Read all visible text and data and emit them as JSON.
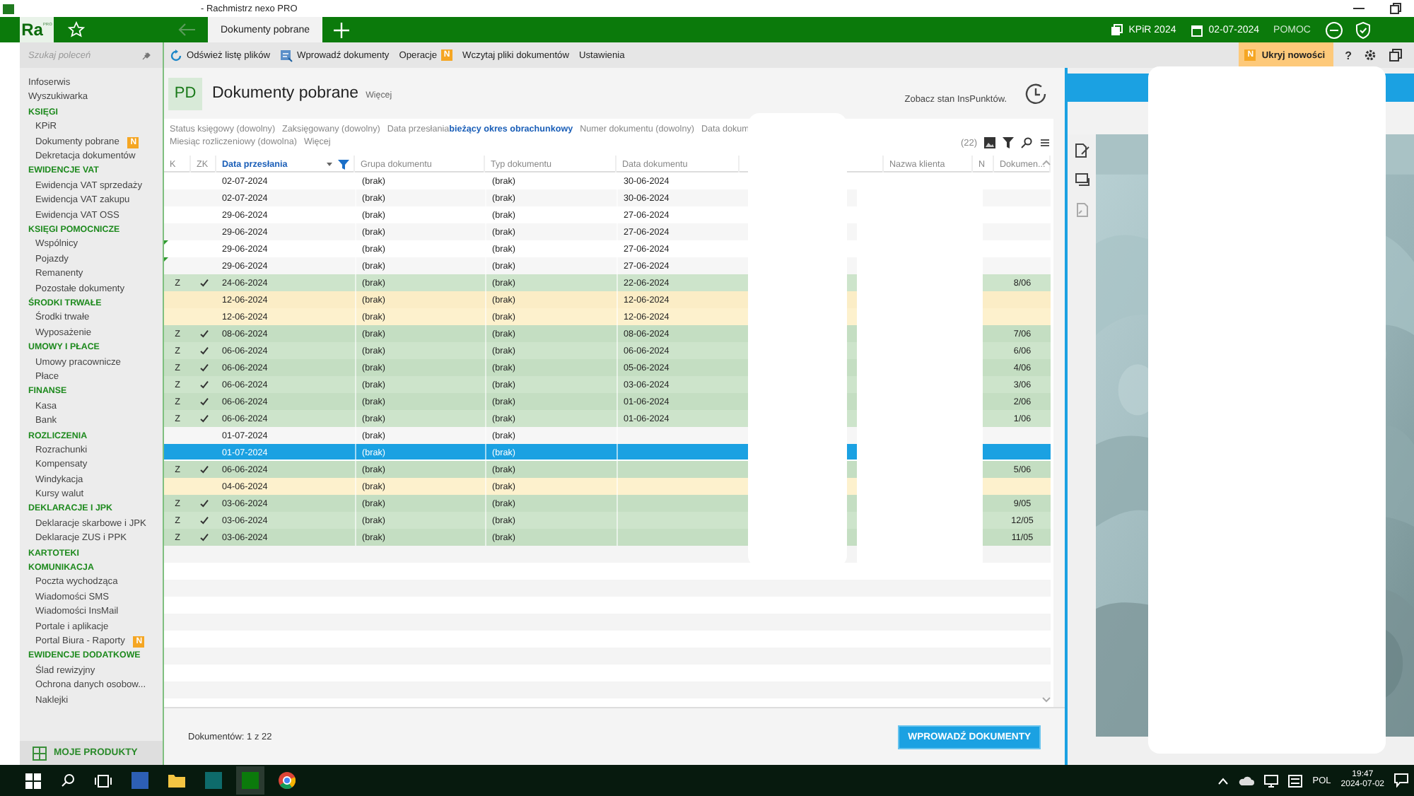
{
  "window": {
    "title": "- Rachmistrz nexo PRO"
  },
  "topbar": {
    "logo": "Ra",
    "logo_sup": "PRO",
    "tab": "Dokumenty pobrane",
    "year": "KPiR 2024",
    "date": "02-07-2024",
    "help": "POMOC"
  },
  "sidebar": {
    "search_placeholder": "Szukaj poleceń",
    "top_items": [
      "Infoserwis",
      "Wyszukiwarka"
    ],
    "sections": [
      {
        "title": "KSIĘGI",
        "items": [
          {
            "label": "KPiR"
          },
          {
            "label": "Dokumenty pobrane",
            "badge": "N"
          },
          {
            "label": "Dekretacja dokumentów"
          }
        ]
      },
      {
        "title": "EWIDENCJE VAT",
        "items": [
          {
            "label": "Ewidencja VAT sprzedaży"
          },
          {
            "label": "Ewidencja VAT zakupu"
          },
          {
            "label": "Ewidencja VAT OSS"
          }
        ]
      },
      {
        "title": "KSIĘGI POMOCNICZE",
        "items": [
          {
            "label": "Wspólnicy"
          },
          {
            "label": "Pojazdy"
          },
          {
            "label": "Remanenty"
          },
          {
            "label": "Pozostałe dokumenty"
          }
        ]
      },
      {
        "title": "ŚRODKI TRWAŁE",
        "items": [
          {
            "label": "Środki trwałe"
          },
          {
            "label": "Wyposażenie"
          }
        ]
      },
      {
        "title": "UMOWY I PŁACE",
        "items": [
          {
            "label": "Umowy pracownicze"
          },
          {
            "label": "Płace"
          }
        ]
      },
      {
        "title": "FINANSE",
        "items": [
          {
            "label": "Kasa"
          },
          {
            "label": "Bank"
          }
        ]
      },
      {
        "title": "ROZLICZENIA",
        "items": [
          {
            "label": "Rozrachunki"
          },
          {
            "label": "Kompensaty"
          },
          {
            "label": "Windykacja"
          },
          {
            "label": "Kursy walut"
          }
        ]
      },
      {
        "title": "DEKLARACJE I JPK",
        "items": [
          {
            "label": "Deklaracje skarbowe i JPK"
          },
          {
            "label": "Deklaracje ZUS i PPK"
          }
        ]
      },
      {
        "title": "KARTOTEKI"
      },
      {
        "title": "KOMUNIKACJA",
        "items": [
          {
            "label": "Poczta wychodząca"
          },
          {
            "label": "Wiadomości SMS"
          },
          {
            "label": "Wiadomości InsMail"
          },
          {
            "label": "Portale i aplikacje"
          },
          {
            "label": "Portal Biura - Raporty",
            "badge": "N"
          }
        ]
      },
      {
        "title": "EWIDENCJE DODATKOWE",
        "items": [
          {
            "label": "Ślad rewizyjny"
          },
          {
            "label": "Ochrona danych osobow..."
          },
          {
            "label": "Naklejki"
          }
        ]
      }
    ],
    "products": "MOJE PRODUKTY"
  },
  "toolbar": {
    "items": [
      {
        "label": "Odśwież listę plików"
      },
      {
        "label": "Wprowadź dokumenty"
      },
      {
        "label": "Operacje",
        "badge": "N"
      },
      {
        "label": "Wczytaj pliki dokumentów"
      },
      {
        "label": "Ustawienia"
      }
    ],
    "news_badge": "N",
    "news": "Ukryj nowości",
    "help": "?"
  },
  "header": {
    "badge": "PD",
    "title": "Dokumenty pobrane",
    "more": "Więcej",
    "points": "Zobacz stan InsPunktów."
  },
  "filters": {
    "line1": [
      {
        "label": "Status księgowy (dowolny)"
      },
      {
        "label": "Zaksięgowany (dowolny)"
      },
      {
        "label": "Data przesłania",
        "value": "bieżący okres obrachunkowy"
      },
      {
        "label": "Numer dokumentu (dowolny)"
      },
      {
        "label": "Data dokum"
      }
    ],
    "line2": [
      {
        "label": "Miesiąc rozliczeniowy (dowolna)"
      },
      {
        "label": "Więcej"
      }
    ],
    "count": "(22)"
  },
  "table": {
    "columns": [
      "K",
      "ZK",
      "Data przesłania",
      "Grupa dokumentu",
      "Typ dokumentu",
      "Data dokumentu",
      "Nazwa klienta",
      "N",
      "Dokumen..."
    ],
    "rows": [
      {
        "zk": false,
        "sent": "02-07-2024",
        "group": "(brak)",
        "type": "(brak)",
        "doc_date": "30-06-2024",
        "kind": "plain",
        "marked": false,
        "selected": false
      },
      {
        "zk": false,
        "sent": "02-07-2024",
        "group": "(brak)",
        "type": "(brak)",
        "doc_date": "30-06-2024",
        "kind": "plain",
        "marked": false,
        "selected": false
      },
      {
        "zk": false,
        "sent": "29-06-2024",
        "group": "(brak)",
        "type": "(brak)",
        "doc_date": "27-06-2024",
        "kind": "plain",
        "marked": false,
        "selected": false
      },
      {
        "zk": false,
        "sent": "29-06-2024",
        "group": "(brak)",
        "type": "(brak)",
        "doc_date": "27-06-2024",
        "kind": "plain",
        "marked": false,
        "selected": false
      },
      {
        "zk": false,
        "sent": "29-06-2024",
        "group": "(brak)",
        "type": "(brak)",
        "doc_date": "27-06-2024",
        "kind": "plain",
        "marked": true,
        "selected": false
      },
      {
        "zk": false,
        "sent": "29-06-2024",
        "group": "(brak)",
        "type": "(brak)",
        "doc_date": "27-06-2024",
        "kind": "plain",
        "marked": true,
        "selected": false
      },
      {
        "k": "Z",
        "zk": true,
        "sent": "24-06-2024",
        "group": "(brak)",
        "type": "(brak)",
        "doc_date": "22-06-2024",
        "number": "8/06",
        "kind": "booked",
        "marked": false,
        "selected": false
      },
      {
        "zk": false,
        "sent": "12-06-2024",
        "group": "(brak)",
        "type": "(brak)",
        "doc_date": "12-06-2024",
        "kind": "pending",
        "marked": false,
        "selected": false
      },
      {
        "zk": false,
        "sent": "12-06-2024",
        "group": "(brak)",
        "type": "(brak)",
        "doc_date": "12-06-2024",
        "kind": "pending",
        "marked": false,
        "selected": false
      },
      {
        "k": "Z",
        "zk": true,
        "sent": "08-06-2024",
        "group": "(brak)",
        "type": "(brak)",
        "doc_date": "08-06-2024",
        "number": "7/06",
        "kind": "booked",
        "marked": false,
        "selected": false
      },
      {
        "k": "Z",
        "zk": true,
        "sent": "06-06-2024",
        "group": "(brak)",
        "type": "(brak)",
        "doc_date": "06-06-2024",
        "number": "6/06",
        "kind": "booked",
        "marked": false,
        "selected": false
      },
      {
        "k": "Z",
        "zk": true,
        "sent": "06-06-2024",
        "group": "(brak)",
        "type": "(brak)",
        "doc_date": "05-06-2024",
        "number": "4/06",
        "kind": "booked",
        "marked": false,
        "selected": false
      },
      {
        "k": "Z",
        "zk": true,
        "sent": "06-06-2024",
        "group": "(brak)",
        "type": "(brak)",
        "doc_date": "03-06-2024",
        "number": "3/06",
        "kind": "booked",
        "marked": false,
        "selected": false
      },
      {
        "k": "Z",
        "zk": true,
        "sent": "06-06-2024",
        "group": "(brak)",
        "type": "(brak)",
        "doc_date": "01-06-2024",
        "number": "2/06",
        "kind": "booked",
        "marked": false,
        "selected": false
      },
      {
        "k": "Z",
        "zk": true,
        "sent": "06-06-2024",
        "group": "(brak)",
        "type": "(brak)",
        "doc_date": "01-06-2024",
        "number": "1/06",
        "kind": "booked",
        "marked": false,
        "selected": false
      },
      {
        "zk": false,
        "sent": "01-07-2024",
        "group": "(brak)",
        "type": "(brak)",
        "kind": "plain",
        "marked": false,
        "selected": false
      },
      {
        "zk": false,
        "sent": "01-07-2024",
        "group": "(brak)",
        "type": "(brak)",
        "kind": "plain",
        "marked": false,
        "selected": true
      },
      {
        "k": "Z",
        "zk": true,
        "sent": "06-06-2024",
        "group": "(brak)",
        "type": "(brak)",
        "number": "5/06",
        "kind": "booked",
        "marked": false,
        "selected": false
      },
      {
        "zk": false,
        "sent": "04-06-2024",
        "group": "(brak)",
        "type": "(brak)",
        "kind": "pending",
        "marked": false,
        "selected": false
      },
      {
        "k": "Z",
        "zk": true,
        "sent": "03-06-2024",
        "group": "(brak)",
        "type": "(brak)",
        "number": "9/05",
        "kind": "booked",
        "marked": false,
        "selected": false
      },
      {
        "k": "Z",
        "zk": true,
        "sent": "03-06-2024",
        "group": "(brak)",
        "type": "(brak)",
        "number": "12/05",
        "kind": "booked",
        "marked": false,
        "selected": false
      },
      {
        "k": "Z",
        "zk": true,
        "sent": "03-06-2024",
        "group": "(brak)",
        "type": "(brak)",
        "number": "11/05",
        "kind": "booked",
        "marked": false,
        "selected": false
      }
    ]
  },
  "footer": {
    "count": "Dokumentów: 1 z 22",
    "button": "WPROWADŹ DOKUMENTY"
  },
  "taskbar": {
    "lang": "POL",
    "time": "19:47",
    "date": "2024-07-02"
  }
}
